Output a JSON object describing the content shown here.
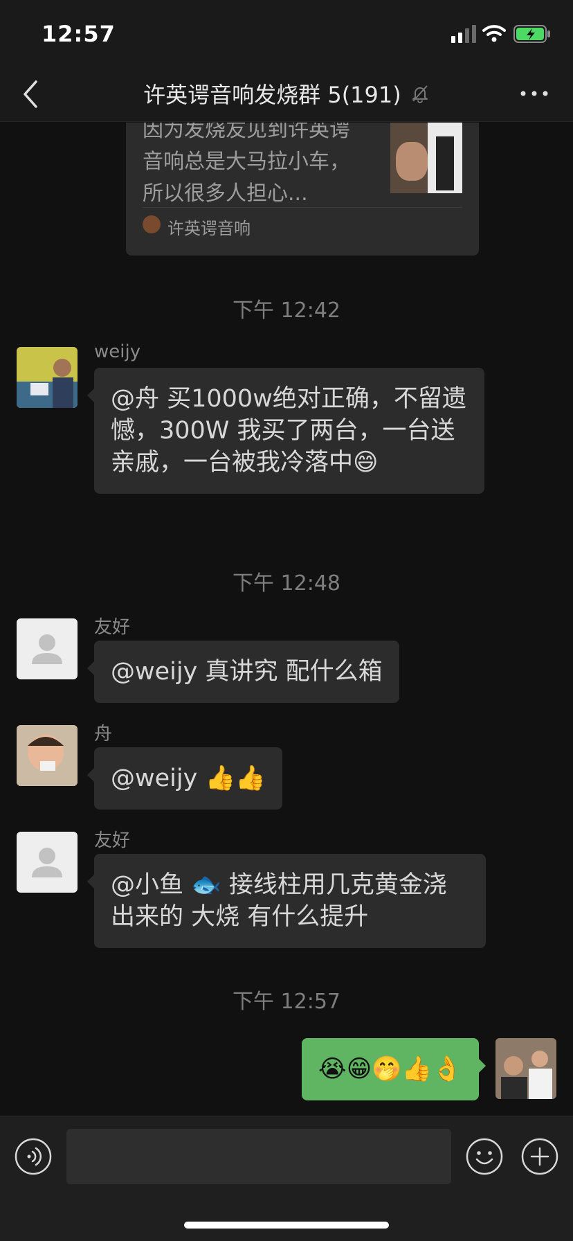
{
  "status_bar": {
    "time": "12:57"
  },
  "nav": {
    "title": "许英谔音响发烧群 5(191)"
  },
  "shared_card": {
    "description": "因为发烧友见到许英谔音响总是大马拉小车，所以很多人担心...",
    "source": "许英谔音响"
  },
  "messages": [
    {
      "type": "time",
      "text": "下午 12:42"
    },
    {
      "type": "msg",
      "sender": "weijy",
      "text": "@舟 买1000w绝对正确，不留遗憾，300W 我买了两台，一台送亲戚，一台被我冷落中😄"
    },
    {
      "type": "time",
      "text": "下午 12:48"
    },
    {
      "type": "msg",
      "sender": "友好",
      "text": "@weijy 真讲究 配什么箱"
    },
    {
      "type": "msg",
      "sender": "舟",
      "text": "@weijy 👍👍"
    },
    {
      "type": "msg",
      "sender": "友好",
      "text": "@小鱼 🐟 接线柱用几克黄金浇出来的 大烧 有什么提升"
    },
    {
      "type": "time",
      "text": "下午 12:57"
    },
    {
      "type": "msg",
      "sender": "me",
      "text": "😭😁🤭👍👌"
    }
  ],
  "input": {
    "placeholder": ""
  },
  "colors": {
    "self_bubble": "#5fb562",
    "other_bubble": "#2c2c2c",
    "background": "#111111"
  }
}
